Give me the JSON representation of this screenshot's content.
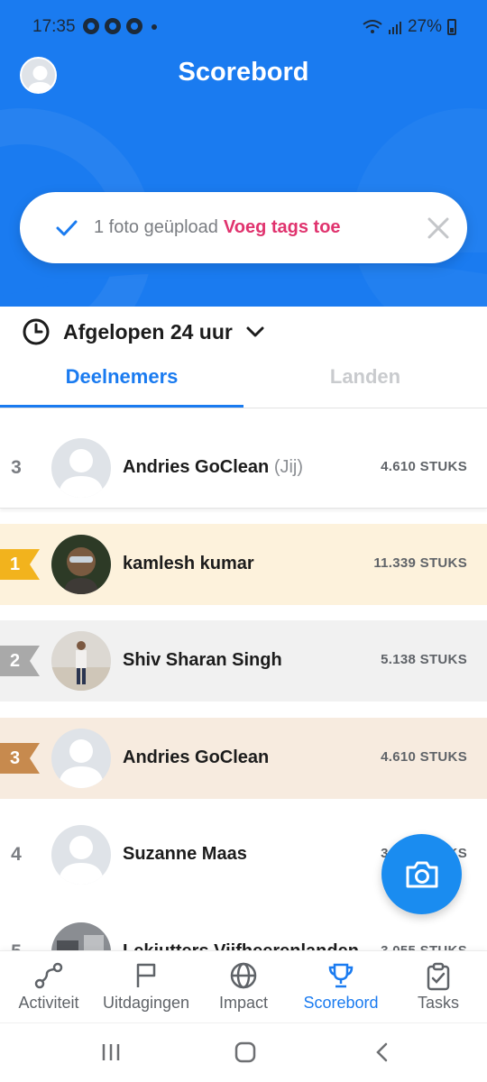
{
  "status_bar": {
    "time": "17:35",
    "battery": "27%"
  },
  "header": {
    "title": "Scorebord"
  },
  "toast": {
    "message": "1 foto geüpload",
    "action": "Voeg tags toe"
  },
  "filter": {
    "label": "Afgelopen 24 uur"
  },
  "tabs": [
    {
      "label": "Deelnemers",
      "active": true
    },
    {
      "label": "Landen",
      "active": false
    }
  ],
  "my_row": {
    "rank": "3",
    "name": "Andries GoClean",
    "you_tag": "(Jij)",
    "count": "4.610 STUKS"
  },
  "rows": [
    {
      "rank": "1",
      "name": "kamlesh kumar",
      "count": "11.339 STUKS"
    },
    {
      "rank": "2",
      "name": "Shiv Sharan Singh",
      "count": "5.138 STUKS"
    },
    {
      "rank": "3",
      "name": "Andries GoClean",
      "count": "4.610 STUKS"
    },
    {
      "rank": "4",
      "name": "Suzanne Maas",
      "count": "3.___ STUKS"
    },
    {
      "rank": "5",
      "name": "Lekjutters Vijfheerenlanden",
      "count": "3.055 STUKS"
    }
  ],
  "nav": [
    {
      "label": "Activiteit",
      "icon": "route-icon"
    },
    {
      "label": "Uitdagingen",
      "icon": "flag-icon"
    },
    {
      "label": "Impact",
      "icon": "globe-icon"
    },
    {
      "label": "Scorebord",
      "icon": "trophy-icon",
      "active": true
    },
    {
      "label": "Tasks",
      "icon": "clipboard-check-icon"
    }
  ],
  "colors": {
    "primary": "#1a7bf0",
    "accent": "#e0336e",
    "gold": "#f2b31d",
    "silver": "#a9a9a9",
    "bronze": "#c78a4e"
  }
}
